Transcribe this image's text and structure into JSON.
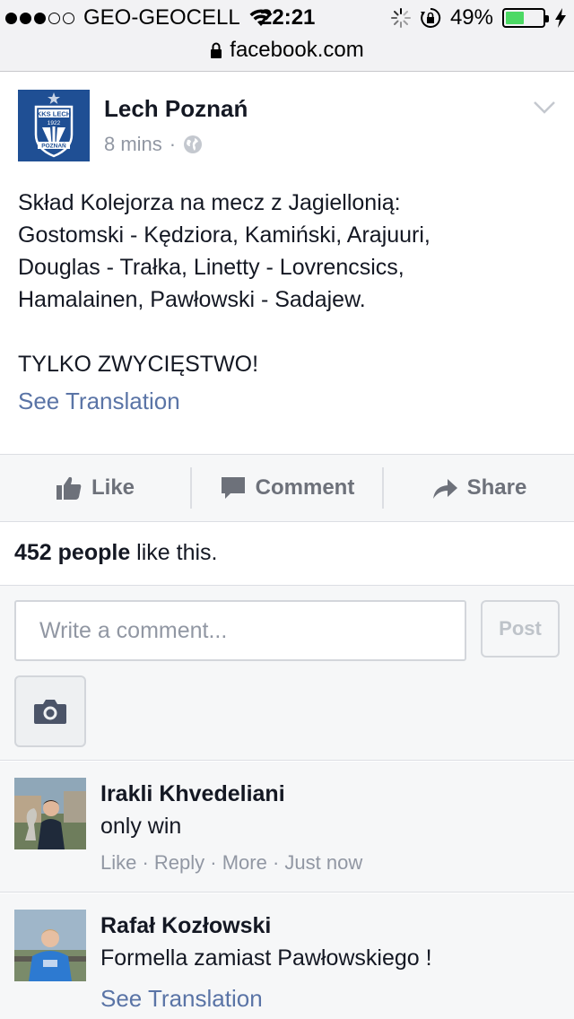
{
  "status_bar": {
    "signal_dots_filled": 3,
    "signal_dots_total": 5,
    "carrier": "GEO-GEOCELL",
    "time": "22:21",
    "battery_percent_text": "49%",
    "battery_level": 0.49,
    "battery_color": "#4cd964"
  },
  "url_bar": {
    "domain": "facebook.com"
  },
  "post": {
    "page_name": "Lech Poznań",
    "timestamp": "8 mins",
    "meta_separator": "·",
    "body": "Skład Kolejorza na mecz z Jagiellonią:\nGostomski - Kędziora, Kamiński, Arajuuri,\nDouglas - Trałka, Linetty - Lovrencsics,\nHamalainen, Pawłowski - Sadajew.\n\nTYLKO ZWYCIĘSTWO!",
    "see_translation": "See Translation",
    "logo_text_top": "KKS LECH",
    "logo_text_year": "1922",
    "logo_text_bottom": "POZNAŃ"
  },
  "actions": {
    "like": "Like",
    "comment": "Comment",
    "share": "Share"
  },
  "likes": {
    "count_label": "452 people",
    "suffix": " like this."
  },
  "composer": {
    "placeholder": "Write a comment...",
    "post_button": "Post"
  },
  "comments": [
    {
      "author": "Irakli Khvedeliani",
      "text": "only win",
      "like": "Like",
      "reply": "Reply",
      "more": "More",
      "time": "Just now",
      "sep": " · "
    },
    {
      "author": "Rafał Kozłowski",
      "text": "Formella zamiast Pawłowskiego !",
      "see_translation": "See Translation"
    }
  ],
  "colors": {
    "link_blue": "#5a74a6",
    "meta_gray": "#9197a3",
    "page_logo_blue": "#1f4f94"
  },
  "icons": [
    "wifi-icon",
    "activity-spinner-icon",
    "rotation-lock-icon",
    "battery-icon",
    "charging-bolt-icon",
    "padlock-icon",
    "globe-icon",
    "chevron-down-icon",
    "thumbs-up-icon",
    "speech-bubble-icon",
    "share-arrow-icon",
    "camera-icon"
  ]
}
